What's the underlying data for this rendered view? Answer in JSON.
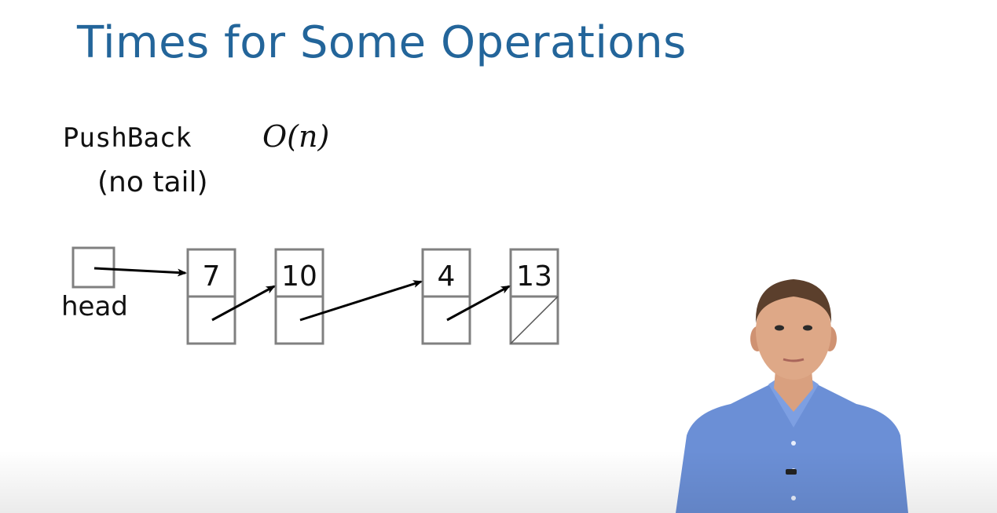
{
  "slide": {
    "title": "Times for Some Operations"
  },
  "operation": {
    "name": "PushBack",
    "note": "(no tail)",
    "time": "O(n)"
  },
  "diagram": {
    "head_label": "head",
    "nodes": [
      {
        "key": "7"
      },
      {
        "key": "10"
      },
      {
        "key": "4"
      },
      {
        "key": "13",
        "next": "null"
      }
    ]
  },
  "colors": {
    "title": "#23659a",
    "box_border": "#808080",
    "arrow": "#000000",
    "shirt": "#6b8fd6"
  }
}
